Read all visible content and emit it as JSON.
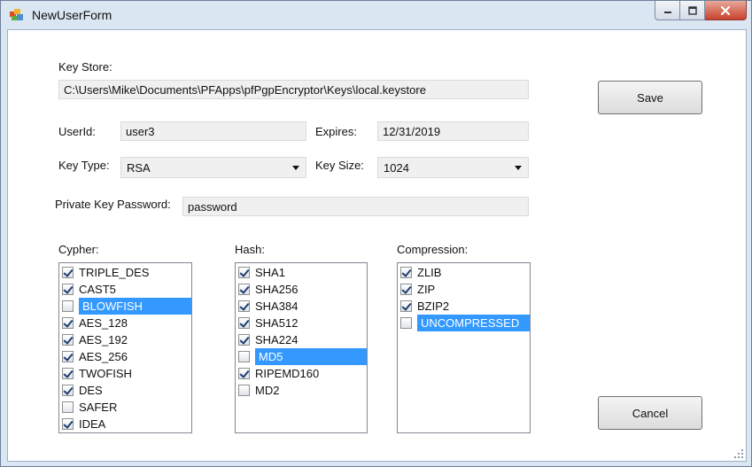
{
  "window": {
    "title": "NewUserForm"
  },
  "form": {
    "key_store_label": "Key Store:",
    "key_store_value": "C:\\Users\\Mike\\Documents\\PFApps\\pfPgpEncryptor\\Keys\\local.keystore",
    "userid_label": "UserId:",
    "userid_value": "user3",
    "expires_label": "Expires:",
    "expires_value": "12/31/2019",
    "key_type_label": "Key Type:",
    "key_type_value": "RSA",
    "key_size_label": "Key Size:",
    "key_size_value": "1024",
    "password_label": "Private Key Password:",
    "password_value": "password"
  },
  "buttons": {
    "save": "Save",
    "cancel": "Cancel"
  },
  "cypher": {
    "label": "Cypher:",
    "items": [
      {
        "label": "TRIPLE_DES",
        "checked": true
      },
      {
        "label": "CAST5",
        "checked": true
      },
      {
        "label": "BLOWFISH",
        "checked": false,
        "selected": true
      },
      {
        "label": "AES_128",
        "checked": true
      },
      {
        "label": "AES_192",
        "checked": true
      },
      {
        "label": "AES_256",
        "checked": true
      },
      {
        "label": "TWOFISH",
        "checked": true
      },
      {
        "label": "DES",
        "checked": true
      },
      {
        "label": "SAFER",
        "checked": false
      },
      {
        "label": "IDEA",
        "checked": true
      }
    ]
  },
  "hash": {
    "label": "Hash:",
    "items": [
      {
        "label": "SHA1",
        "checked": true
      },
      {
        "label": "SHA256",
        "checked": true
      },
      {
        "label": "SHA384",
        "checked": true
      },
      {
        "label": "SHA512",
        "checked": true
      },
      {
        "label": "SHA224",
        "checked": true
      },
      {
        "label": "MD5",
        "checked": false,
        "selected": true
      },
      {
        "label": "RIPEMD160",
        "checked": true
      },
      {
        "label": "MD2",
        "checked": false
      }
    ]
  },
  "compression": {
    "label": "Compression:",
    "items": [
      {
        "label": "ZLIB",
        "checked": true
      },
      {
        "label": "ZIP",
        "checked": true
      },
      {
        "label": "BZIP2",
        "checked": true
      },
      {
        "label": "UNCOMPRESSED",
        "checked": false,
        "selected": true
      }
    ]
  },
  "colors": {
    "selection": "#3399ff",
    "window_frame": "#dbe6f3",
    "close_button": "#c9422d"
  }
}
